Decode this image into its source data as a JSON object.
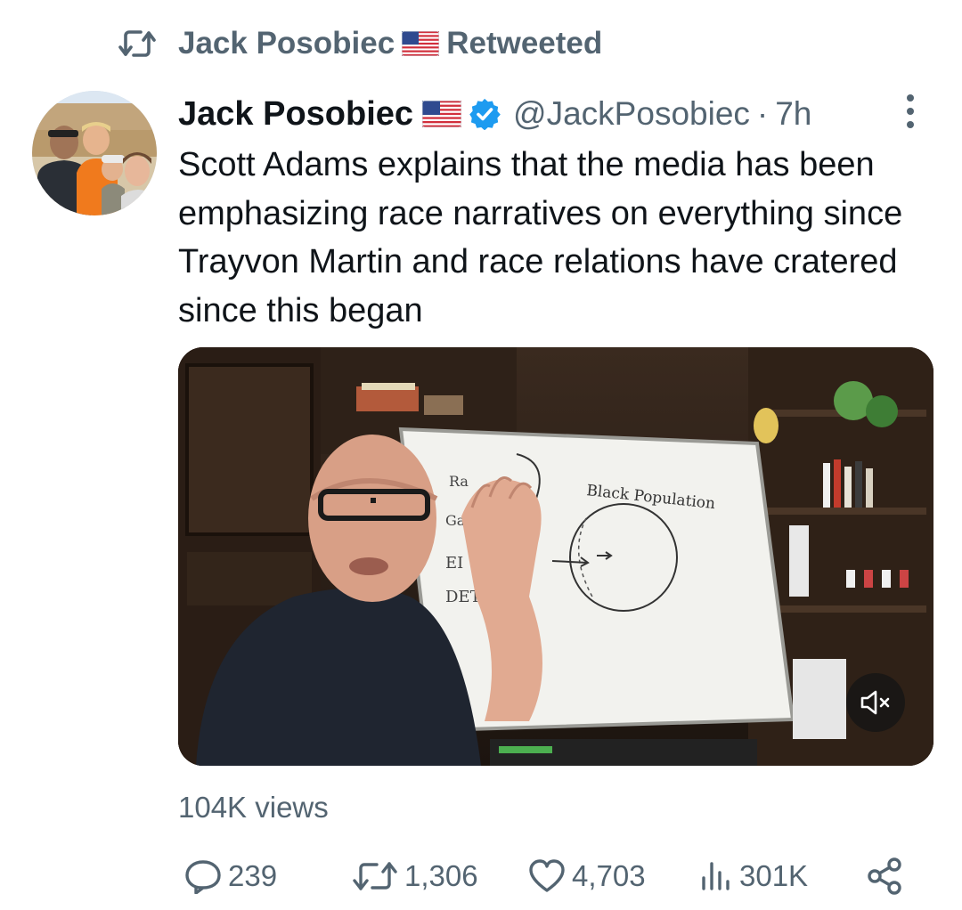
{
  "retweet_header": {
    "icon": "retweet-icon",
    "user_name": "Jack Posobiec",
    "flag": "us-flag-icon",
    "label": "Retweeted"
  },
  "tweet": {
    "author": {
      "name": "Jack Posobiec",
      "flag": "us-flag-icon",
      "verified": true,
      "handle": "@JackPosobiec",
      "separator": "·",
      "time": "7h"
    },
    "text": "Scott Adams explains that the media has been emphasizing race narratives on everything since Trayvon Martin and race relations have cratered since this began",
    "media": {
      "type": "video",
      "whiteboard_text": {
        "heading": "Black Population",
        "left_col": [
          "Ra",
          "Ga",
          "EI",
          "DET"
        ]
      },
      "mute_icon": "muted-speaker-icon"
    },
    "views": "104K views",
    "actions": {
      "reply_count": "239",
      "retweet_count": "1,306",
      "like_count": "4,703",
      "impressions_count": "301K"
    }
  },
  "colors": {
    "secondary_text": "#536471",
    "primary_text": "#0f1419",
    "verified_blue": "#1d9bf0"
  }
}
